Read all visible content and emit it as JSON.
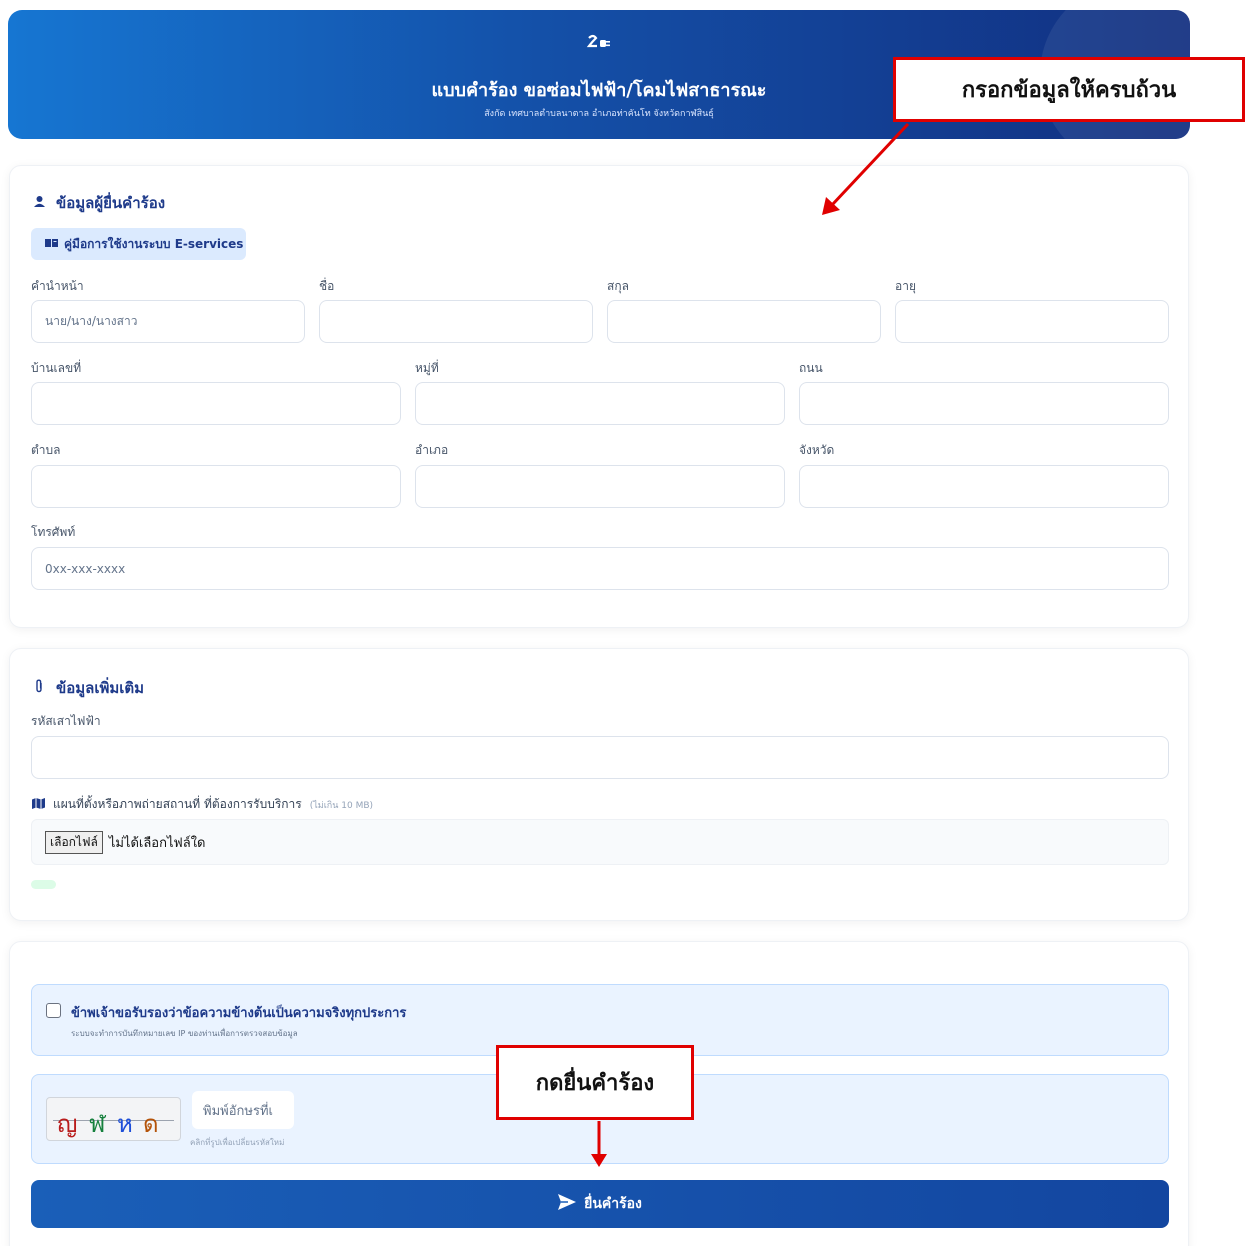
{
  "header": {
    "logo": "ऱ⊂",
    "title": "แบบคำร้อง ขอซ่อมไฟฟ้า/โคมไฟสาธารณะ",
    "subtitle": "สังกัด เทศบาลตำบลนาตาล อำเภอท่าคันโท จังหวัดกาฬสินธุ์"
  },
  "applicant": {
    "section_title": "ข้อมูลผู้ยื่นคำร้อง",
    "manual_button": "คู่มือการใช้งานระบบ E-services",
    "fields": {
      "prefix_label": "คำนำหน้า",
      "prefix_placeholder": "นาย/นาง/นางสาว",
      "firstname_label": "ชื่อ",
      "lastname_label": "สกุล",
      "age_label": "อายุ",
      "house_no_label": "บ้านเลขที่",
      "moo_label": "หมู่ที่",
      "road_label": "ถนน",
      "tambon_label": "ตำบล",
      "amphoe_label": "อำเภอ",
      "province_label": "จังหวัด",
      "phone_label": "โทรศัพท์",
      "phone_placeholder": "0xx-xxx-xxxx"
    }
  },
  "additional": {
    "section_title": "ข้อมูลเพิ่มเติม",
    "pole_code_label": "รหัสเสาไฟฟ้า",
    "map_label": "แผนที่ตั้งหรือภาพถ่ายสถานที่ ที่ต้องการรับบริการ",
    "map_note": "(ไม่เกิน 10 MB)",
    "file_button": "เลือกไฟล์",
    "file_status": "ไม่ได้เลือกไฟล์ใด"
  },
  "confirm": {
    "certify_text": "ข้าพเจ้าขอรับรองว่าข้อความข้างต้นเป็นความจริงทุกประการ",
    "certify_note": "ระบบจะทำการบันทึกหมายเลข IP ของท่านเพื่อการตรวจสอบข้อมูล",
    "captcha_chars": [
      "ญ",
      "ฬ",
      "ห",
      "ด"
    ],
    "captcha_colors": [
      "#b91c1c",
      "#15803d",
      "#1d4ed8",
      "#b45309"
    ],
    "captcha_placeholder": "พิมพ์อักษรที่เ",
    "captcha_hint": "คลิกที่รูปเพื่อเปลี่ยนรหัสใหม่",
    "submit_label": "ยื่นคำร้อง"
  },
  "annotations": {
    "fill_all": "กรอกข้อมูลให้ครบถ้วน",
    "press_submit": "กดยื่นคำร้อง"
  },
  "icons": {
    "user": "user-icon",
    "book": "book-icon",
    "paperclip": "paperclip-icon",
    "map": "map-icon",
    "send": "send-icon"
  }
}
